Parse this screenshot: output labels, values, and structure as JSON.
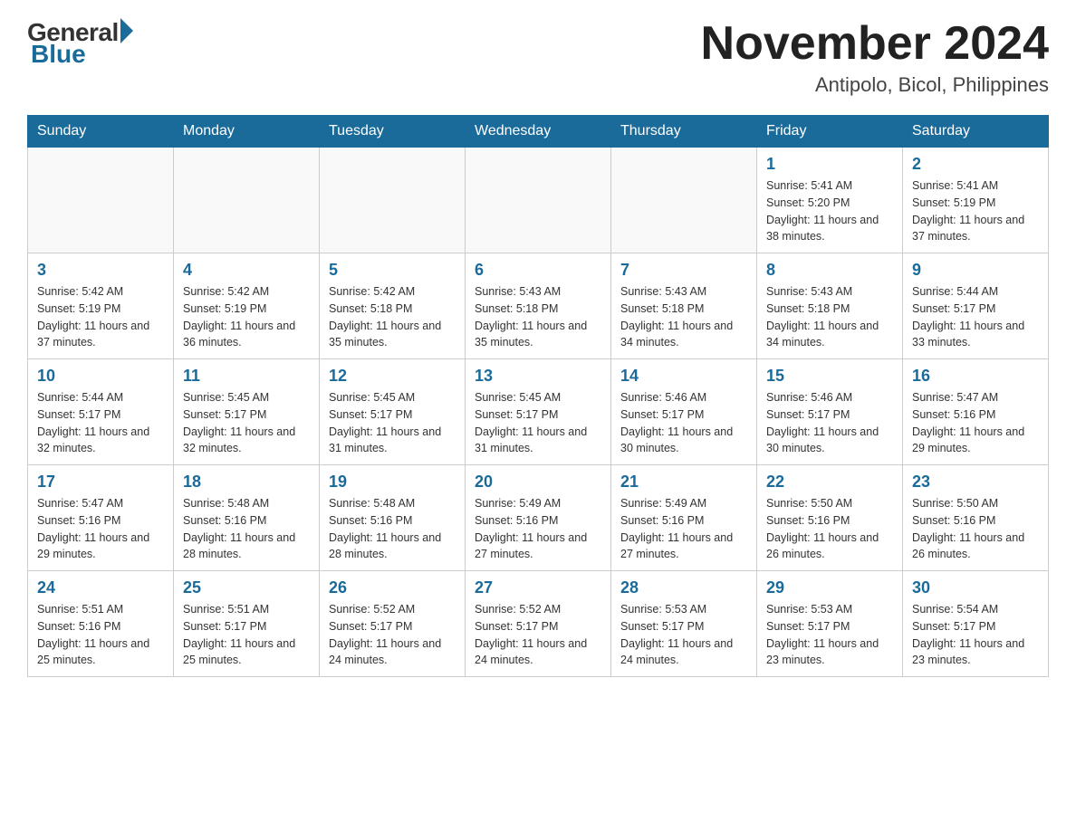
{
  "header": {
    "logo_general": "General",
    "logo_blue": "Blue",
    "month_title": "November 2024",
    "location": "Antipolo, Bicol, Philippines"
  },
  "days_of_week": [
    "Sunday",
    "Monday",
    "Tuesday",
    "Wednesday",
    "Thursday",
    "Friday",
    "Saturday"
  ],
  "weeks": [
    [
      {
        "day": "",
        "info": ""
      },
      {
        "day": "",
        "info": ""
      },
      {
        "day": "",
        "info": ""
      },
      {
        "day": "",
        "info": ""
      },
      {
        "day": "",
        "info": ""
      },
      {
        "day": "1",
        "info": "Sunrise: 5:41 AM\nSunset: 5:20 PM\nDaylight: 11 hours and 38 minutes."
      },
      {
        "day": "2",
        "info": "Sunrise: 5:41 AM\nSunset: 5:19 PM\nDaylight: 11 hours and 37 minutes."
      }
    ],
    [
      {
        "day": "3",
        "info": "Sunrise: 5:42 AM\nSunset: 5:19 PM\nDaylight: 11 hours and 37 minutes."
      },
      {
        "day": "4",
        "info": "Sunrise: 5:42 AM\nSunset: 5:19 PM\nDaylight: 11 hours and 36 minutes."
      },
      {
        "day": "5",
        "info": "Sunrise: 5:42 AM\nSunset: 5:18 PM\nDaylight: 11 hours and 35 minutes."
      },
      {
        "day": "6",
        "info": "Sunrise: 5:43 AM\nSunset: 5:18 PM\nDaylight: 11 hours and 35 minutes."
      },
      {
        "day": "7",
        "info": "Sunrise: 5:43 AM\nSunset: 5:18 PM\nDaylight: 11 hours and 34 minutes."
      },
      {
        "day": "8",
        "info": "Sunrise: 5:43 AM\nSunset: 5:18 PM\nDaylight: 11 hours and 34 minutes."
      },
      {
        "day": "9",
        "info": "Sunrise: 5:44 AM\nSunset: 5:17 PM\nDaylight: 11 hours and 33 minutes."
      }
    ],
    [
      {
        "day": "10",
        "info": "Sunrise: 5:44 AM\nSunset: 5:17 PM\nDaylight: 11 hours and 32 minutes."
      },
      {
        "day": "11",
        "info": "Sunrise: 5:45 AM\nSunset: 5:17 PM\nDaylight: 11 hours and 32 minutes."
      },
      {
        "day": "12",
        "info": "Sunrise: 5:45 AM\nSunset: 5:17 PM\nDaylight: 11 hours and 31 minutes."
      },
      {
        "day": "13",
        "info": "Sunrise: 5:45 AM\nSunset: 5:17 PM\nDaylight: 11 hours and 31 minutes."
      },
      {
        "day": "14",
        "info": "Sunrise: 5:46 AM\nSunset: 5:17 PM\nDaylight: 11 hours and 30 minutes."
      },
      {
        "day": "15",
        "info": "Sunrise: 5:46 AM\nSunset: 5:17 PM\nDaylight: 11 hours and 30 minutes."
      },
      {
        "day": "16",
        "info": "Sunrise: 5:47 AM\nSunset: 5:16 PM\nDaylight: 11 hours and 29 minutes."
      }
    ],
    [
      {
        "day": "17",
        "info": "Sunrise: 5:47 AM\nSunset: 5:16 PM\nDaylight: 11 hours and 29 minutes."
      },
      {
        "day": "18",
        "info": "Sunrise: 5:48 AM\nSunset: 5:16 PM\nDaylight: 11 hours and 28 minutes."
      },
      {
        "day": "19",
        "info": "Sunrise: 5:48 AM\nSunset: 5:16 PM\nDaylight: 11 hours and 28 minutes."
      },
      {
        "day": "20",
        "info": "Sunrise: 5:49 AM\nSunset: 5:16 PM\nDaylight: 11 hours and 27 minutes."
      },
      {
        "day": "21",
        "info": "Sunrise: 5:49 AM\nSunset: 5:16 PM\nDaylight: 11 hours and 27 minutes."
      },
      {
        "day": "22",
        "info": "Sunrise: 5:50 AM\nSunset: 5:16 PM\nDaylight: 11 hours and 26 minutes."
      },
      {
        "day": "23",
        "info": "Sunrise: 5:50 AM\nSunset: 5:16 PM\nDaylight: 11 hours and 26 minutes."
      }
    ],
    [
      {
        "day": "24",
        "info": "Sunrise: 5:51 AM\nSunset: 5:16 PM\nDaylight: 11 hours and 25 minutes."
      },
      {
        "day": "25",
        "info": "Sunrise: 5:51 AM\nSunset: 5:17 PM\nDaylight: 11 hours and 25 minutes."
      },
      {
        "day": "26",
        "info": "Sunrise: 5:52 AM\nSunset: 5:17 PM\nDaylight: 11 hours and 24 minutes."
      },
      {
        "day": "27",
        "info": "Sunrise: 5:52 AM\nSunset: 5:17 PM\nDaylight: 11 hours and 24 minutes."
      },
      {
        "day": "28",
        "info": "Sunrise: 5:53 AM\nSunset: 5:17 PM\nDaylight: 11 hours and 24 minutes."
      },
      {
        "day": "29",
        "info": "Sunrise: 5:53 AM\nSunset: 5:17 PM\nDaylight: 11 hours and 23 minutes."
      },
      {
        "day": "30",
        "info": "Sunrise: 5:54 AM\nSunset: 5:17 PM\nDaylight: 11 hours and 23 minutes."
      }
    ]
  ]
}
